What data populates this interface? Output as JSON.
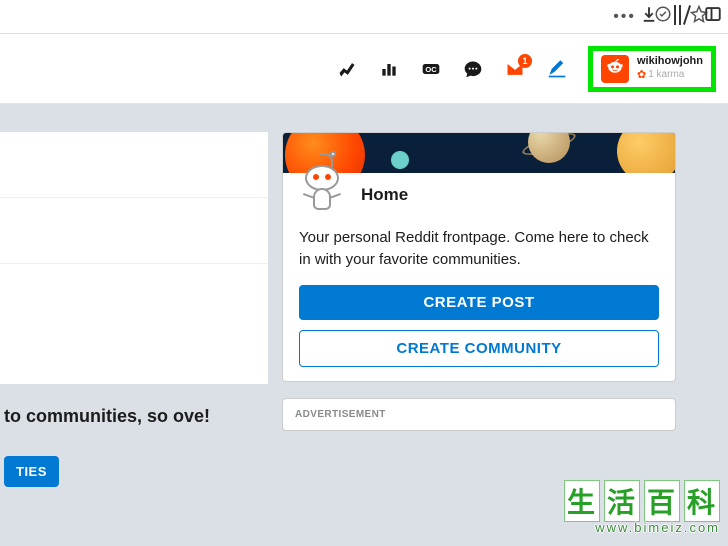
{
  "browser": {
    "menu": "•••"
  },
  "header": {
    "envelope_badge": "1",
    "user": {
      "name": "wikihowjohn",
      "karma": "1 karma"
    }
  },
  "left": {
    "text": "to communities, so ove!",
    "button": "TIES"
  },
  "home_card": {
    "title": "Home",
    "description": "Your personal Reddit frontpage. Come here to check in with your favorite communities.",
    "create_post": "CREATE POST",
    "create_community": "CREATE COMMUNITY"
  },
  "ad": {
    "label": "ADVERTISEMENT"
  },
  "watermark": {
    "cn1": "生",
    "cn2": "活",
    "cn3": "百",
    "cn4": "科",
    "url": "www.bimeiz.com"
  }
}
